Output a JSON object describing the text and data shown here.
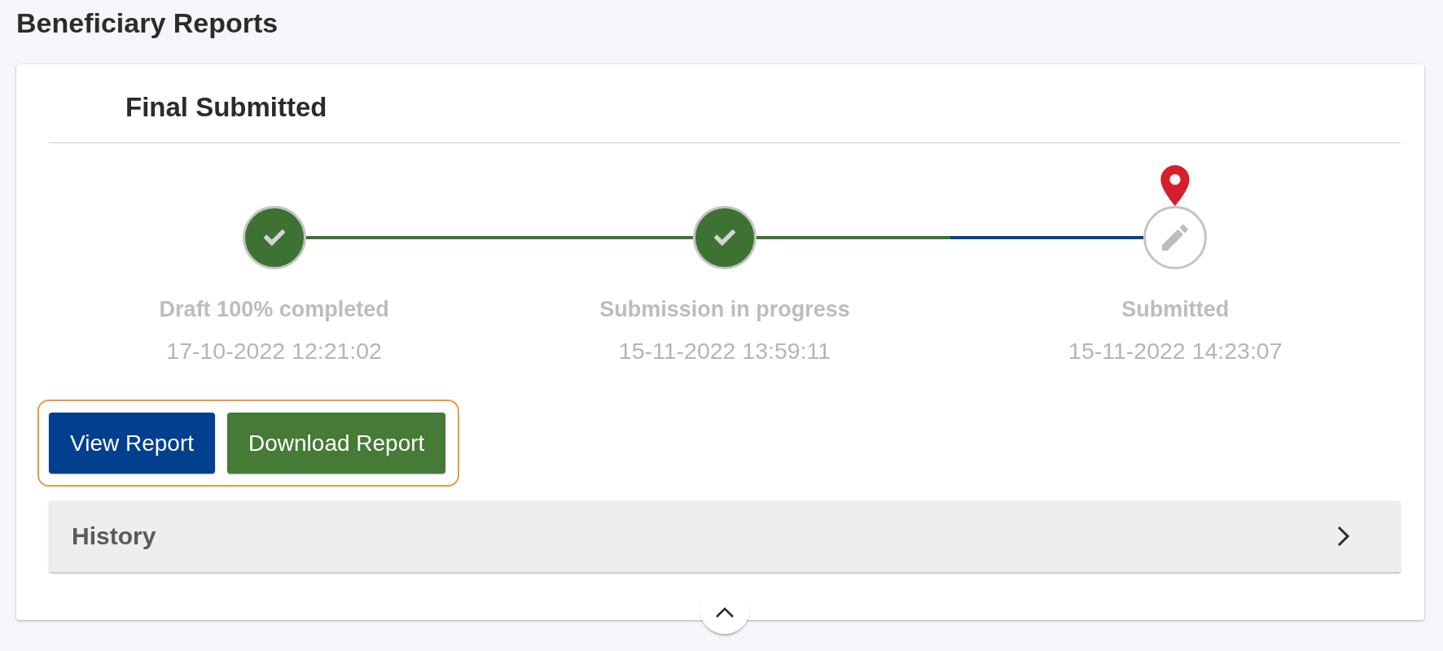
{
  "page": {
    "title": "Beneficiary Reports"
  },
  "card": {
    "title": "Final Submitted",
    "expanded": true,
    "steps": [
      {
        "label": "Draft 100% completed",
        "date": "17-10-2022 12:21:02",
        "done": true,
        "current": false
      },
      {
        "label": "Submission in progress",
        "date": "15-11-2022 13:59:11",
        "done": true,
        "current": false
      },
      {
        "label": "Submitted",
        "date": "15-11-2022 14:23:07",
        "done": false,
        "current": true
      }
    ],
    "action_group": {
      "highlighted": true,
      "buttons": [
        {
          "label": "View Report",
          "kind": "primary"
        },
        {
          "label": "Download Report",
          "kind": "success"
        }
      ]
    },
    "history": {
      "title": "History",
      "expanded": false
    }
  }
}
